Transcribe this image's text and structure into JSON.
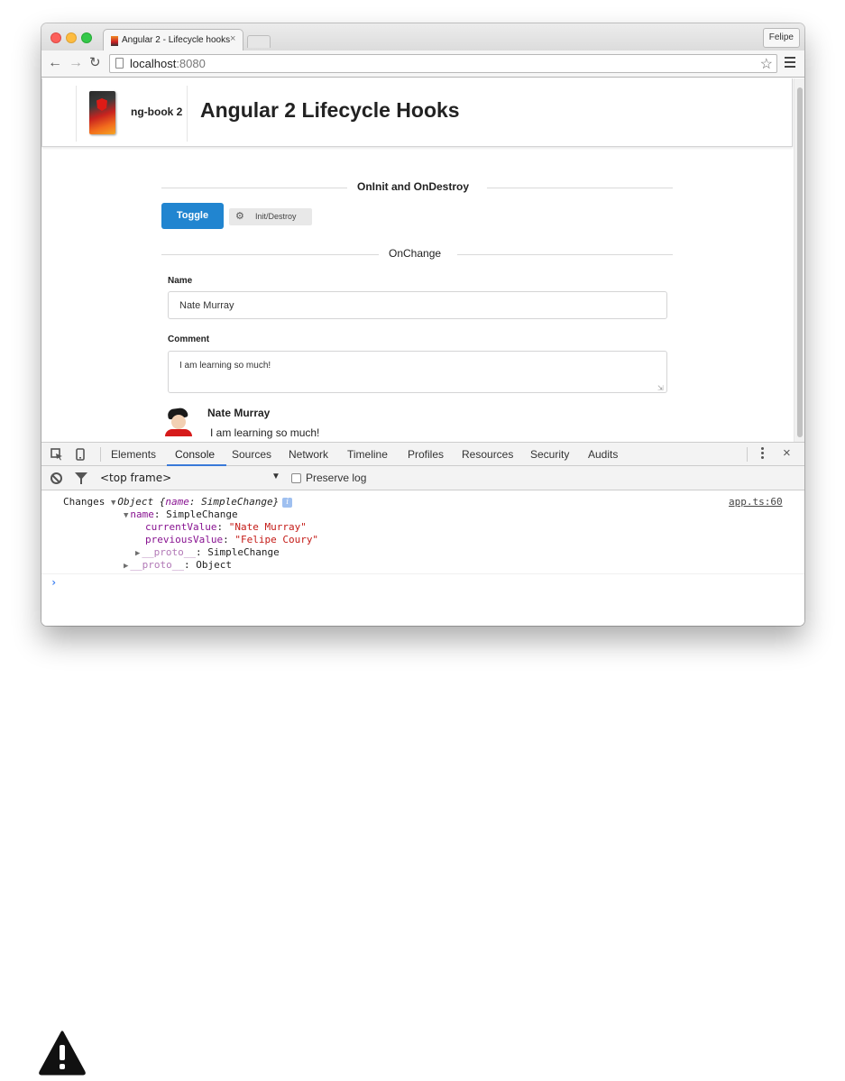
{
  "browser": {
    "tab_title": "Angular 2 - Lifecycle hooks",
    "tab_close": "×",
    "profile_name": "Felipe",
    "url_host": "localhost",
    "url_port": ":8080",
    "icons": [
      "back-icon",
      "forward-icon",
      "reload-icon",
      "page-icon",
      "star-icon",
      "menu-icon"
    ]
  },
  "header": {
    "brand": "ng-book 2",
    "title": "Angular 2 Lifecycle Hooks"
  },
  "sections": {
    "oninit_title": "OnInit and OnDestroy",
    "onchange_title": "OnChange"
  },
  "controls": {
    "toggle_label": "Toggle",
    "init_destroy_label": "Init/Destroy"
  },
  "form": {
    "name_label": "Name",
    "name_value": "Nate Murray",
    "comment_label": "Comment",
    "comment_value": "I am learning so much!"
  },
  "comment": {
    "author": "Nate Murray",
    "text": "I am learning so much!"
  },
  "devtools": {
    "tabs": [
      "Elements",
      "Console",
      "Sources",
      "Network",
      "Timeline",
      "Profiles",
      "Resources",
      "Security",
      "Audits"
    ],
    "active_tab": "Console",
    "frame_selector": "<top frame>",
    "preserve_log": "Preserve log",
    "close": "×"
  },
  "console": {
    "label": "Changes",
    "object_prefix": "Object {",
    "object_key": "name",
    "object_value": ": SimpleChange}",
    "source": "app.ts:60",
    "name_key": "name",
    "name_type": ": SimpleChange",
    "current_key": "currentValue",
    "current_value": "\"Nate Murray\"",
    "previous_key": "previousValue",
    "previous_value": "\"Felipe Coury\"",
    "proto_key": "__proto__",
    "proto1_value": ": SimpleChange",
    "proto2_value": ": Object",
    "info_glyph": "i",
    "prompt": "›"
  },
  "colors": {
    "accent_blue": "#2185d0",
    "devtools_active": "#3879d9",
    "string_red": "#c41a16",
    "key_purple": "#881391"
  }
}
